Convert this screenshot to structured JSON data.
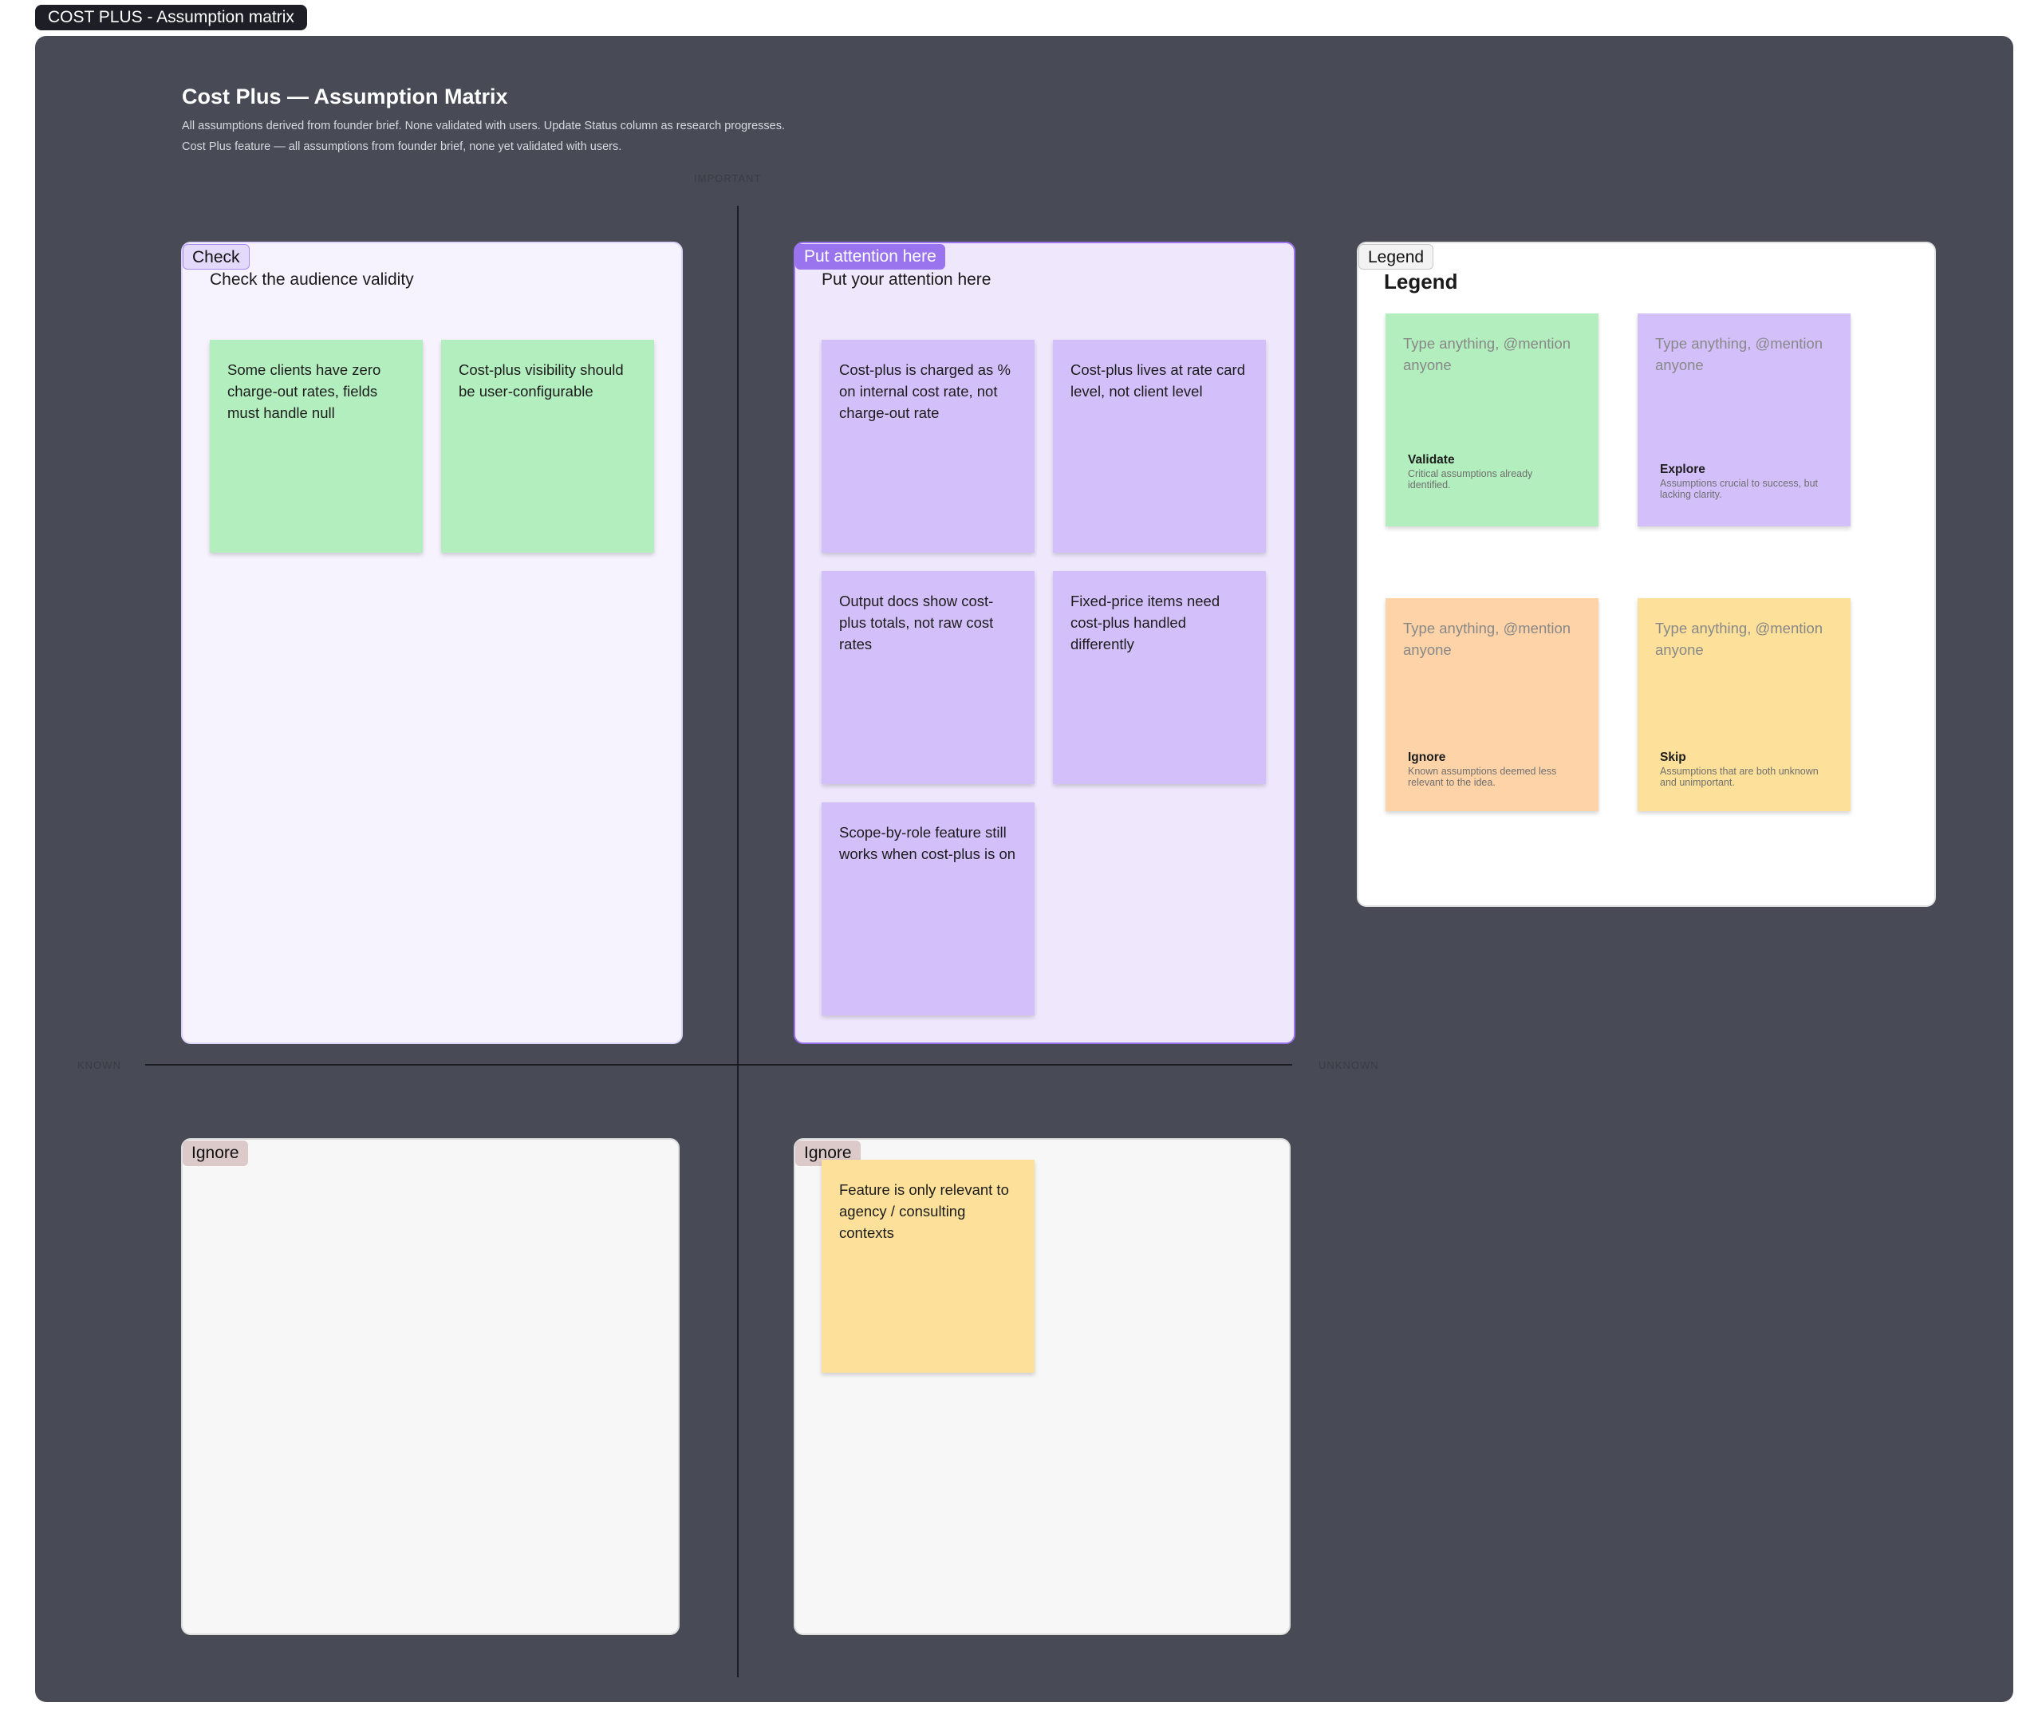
{
  "frame": {
    "tag_label": "COST PLUS - Assumption matrix",
    "title": "Cost Plus — Assumption Matrix",
    "subtitle_1": "All assumptions derived from founder brief. None validated with users. Update Status column as research progresses.",
    "subtitle_2": "Cost Plus feature — all assumptions from founder brief, none yet validated with users."
  },
  "axes": {
    "top": "IMPORTANT",
    "left": "KNOWN",
    "right": "UNKNOWN"
  },
  "sections": {
    "check": {
      "tag": "Check",
      "heading": "Check the audience validity",
      "notes": [
        "Some clients have zero charge-out rates, fields must handle null",
        "Cost-plus visibility should be user-configurable"
      ]
    },
    "attention": {
      "tag": "Put attention here",
      "heading": "Put your attention here",
      "notes": [
        "Cost-plus is charged as % on internal cost rate, not charge-out rate",
        "Cost-plus lives at rate card level, not client level",
        "Output docs show cost-plus totals, not raw cost rates",
        "Fixed-price items need cost-plus handled differently",
        "Scope-by-role feature still works when cost-plus is on"
      ]
    },
    "legend": {
      "tag": "Legend",
      "heading": "Legend",
      "items": [
        {
          "placeholder": "Type anything, @mention anyone",
          "name": "Validate",
          "desc": "Critical assumptions already identified.",
          "color": "#b3eebe"
        },
        {
          "placeholder": "Type anything, @mention anyone",
          "name": "Explore",
          "desc": "Assumptions crucial to success, but lacking clarity.",
          "color": "#d3c0fb"
        },
        {
          "placeholder": "Type anything, @mention anyone",
          "name": "Ignore",
          "desc": "Known assumptions deemed less relevant to the idea.",
          "color": "#fed3a8"
        },
        {
          "placeholder": "Type anything, @mention anyone",
          "name": "Skip",
          "desc": "Assumptions that are both unknown and unimportant.",
          "color": "#fde09a"
        }
      ]
    },
    "ignore_left": {
      "tag": "Ignore"
    },
    "ignore_right": {
      "tag": "Ignore",
      "notes": [
        "Feature is only relevant to agency / consulting contexts"
      ]
    }
  },
  "colors": {
    "canvas": "#484b56",
    "green_note": "#b3eebe",
    "purple_note": "#d3c0fb",
    "yellow_note": "#fde09a",
    "orange_note": "#fed3a8",
    "attention_accent": "#9a73ef"
  }
}
